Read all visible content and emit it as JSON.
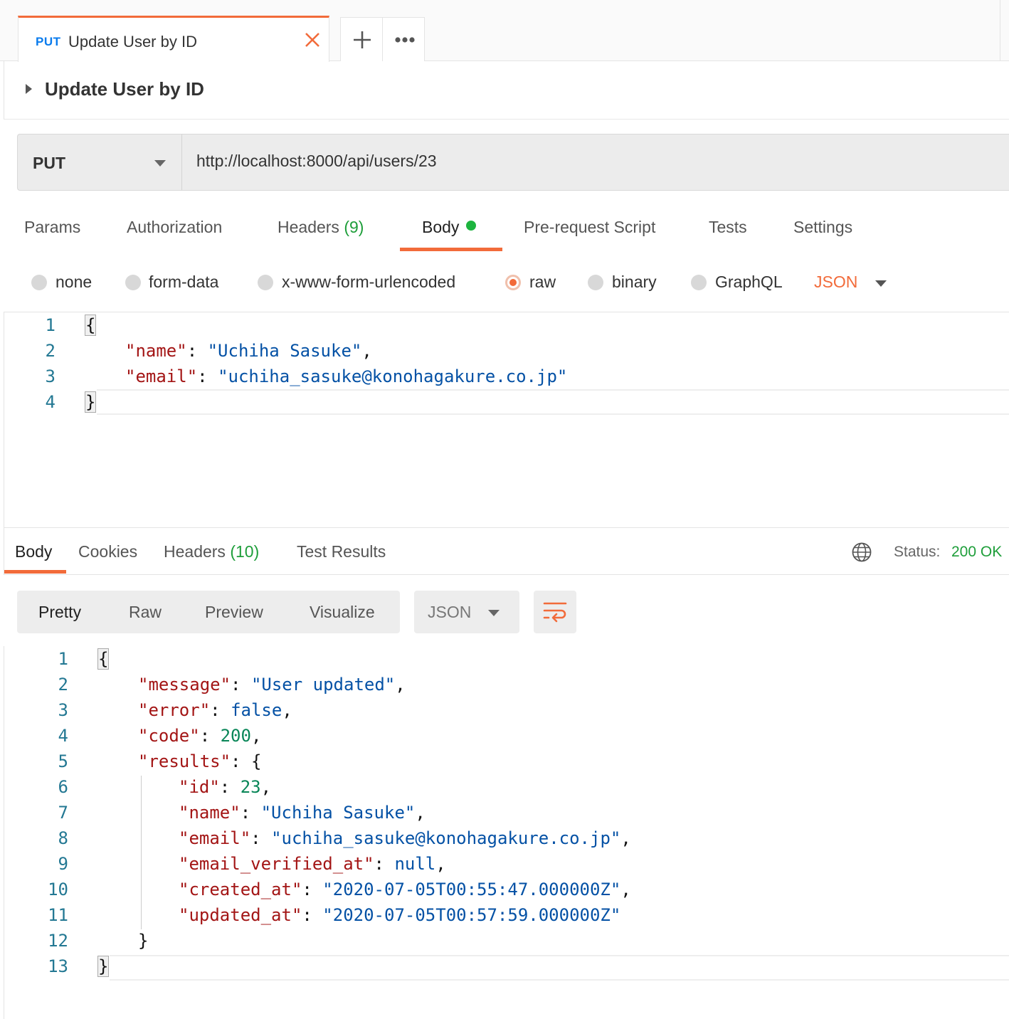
{
  "tab": {
    "method": "PUT",
    "title": "Update User by ID"
  },
  "request": {
    "title": "Update User by ID",
    "method": "PUT",
    "url": "http://localhost:8000/api/users/23",
    "tabs": {
      "params": "Params",
      "authorization": "Authorization",
      "headers": "Headers",
      "headers_count": "(9)",
      "body": "Body",
      "prerequest": "Pre-request Script",
      "tests": "Tests",
      "settings": "Settings"
    },
    "body_types": {
      "none": "none",
      "form_data": "form-data",
      "urlencoded": "x-www-form-urlencoded",
      "raw": "raw",
      "binary": "binary",
      "graphql": "GraphQL",
      "selected": "raw"
    },
    "format": "JSON",
    "body": {
      "line_numbers": [
        "1",
        "2",
        "3",
        "4"
      ],
      "open_brace": "{",
      "close_brace": "}",
      "name_key": "\"name\"",
      "name_value": "\"Uchiha Sasuke\"",
      "email_key": "\"email\"",
      "email_value": "\"uchiha_sasuke@konohagakure.co.jp\""
    }
  },
  "response": {
    "tabs": {
      "body": "Body",
      "cookies": "Cookies",
      "headers": "Headers",
      "headers_count": "(10)",
      "test_results": "Test Results"
    },
    "status_label": "Status:",
    "status_value": "200 OK",
    "view_modes": {
      "pretty": "Pretty",
      "raw": "Raw",
      "preview": "Preview",
      "visualize": "Visualize",
      "selected": "Pretty"
    },
    "format": "JSON",
    "body": {
      "line_numbers": [
        "1",
        "2",
        "3",
        "4",
        "5",
        "6",
        "7",
        "8",
        "9",
        "10",
        "11",
        "12",
        "13"
      ],
      "open_brace": "{",
      "close_brace": "}",
      "message_key": "\"message\"",
      "message_value": "\"User updated\"",
      "error_key": "\"error\"",
      "error_value": "false",
      "code_key": "\"code\"",
      "code_value": "200",
      "results_key": "\"results\"",
      "id_key": "\"id\"",
      "id_value": "23",
      "name_key": "\"name\"",
      "name_value": "\"Uchiha Sasuke\"",
      "email_key": "\"email\"",
      "email_value": "\"uchiha_sasuke@konohagakure.co.jp\"",
      "email_verified_key": "\"email_verified_at\"",
      "email_verified_value": "null",
      "created_key": "\"created_at\"",
      "created_value": "\"2020-07-05T00:55:47.000000Z\"",
      "updated_key": "\"updated_at\"",
      "updated_value": "\"2020-07-05T00:57:59.000000Z\""
    }
  },
  "colors": {
    "accent": "#f26b3a",
    "method_blue": "#097bed",
    "status_green": "#1e9e3a",
    "json_key": "#a31515",
    "json_string": "#0451a5",
    "json_number": "#098658"
  }
}
